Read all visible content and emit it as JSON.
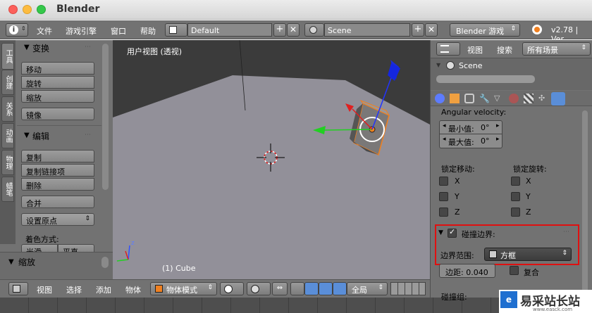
{
  "window": {
    "title": "Blender"
  },
  "menubar": {
    "items": [
      "文件",
      "游戏引擎",
      "窗口",
      "帮助"
    ],
    "layout_value": "Default",
    "scene_value": "Scene",
    "engine_value": "Blender 游戏",
    "version": "v2.78 | Ver"
  },
  "toolshelf": {
    "tabs": [
      "工具",
      "创建",
      "关系",
      "动画",
      "物理",
      "蜡笔"
    ],
    "transform": {
      "title": "变换",
      "buttons": [
        "移动",
        "旋转",
        "缩放"
      ],
      "mirror": "镜像"
    },
    "edit": {
      "title": "编辑",
      "buttons": [
        "复制",
        "复制链接项",
        "删除"
      ],
      "join": "合并",
      "origin": "设置原点",
      "shading_label": "着色方式:",
      "shading_opts": [
        "光滑",
        "平直"
      ]
    },
    "scale_panel": "缩放"
  },
  "viewport": {
    "view_label": "用户视图 (透视)",
    "object_label": "(1) Cube",
    "axis_label": "z"
  },
  "bottombar": {
    "items": [
      "视图",
      "选择",
      "添加",
      "物体"
    ],
    "mode": "物体模式",
    "orientation": "全局"
  },
  "outliner": {
    "menu": [
      "视图",
      "搜索"
    ],
    "filter": "所有场景",
    "scene": "Scene"
  },
  "properties": {
    "angular_velocity": "Angular velocity:",
    "min_label": "最小值:",
    "min_value": "0°",
    "max_label": "最大值:",
    "max_value": "0°",
    "lock_move": "锁定移动:",
    "lock_rot": "锁定旋转:",
    "axes": [
      "X",
      "Y",
      "Z"
    ],
    "bounds_title": "碰撞边界:",
    "bounds_range_label": "边界范围:",
    "bounds_range_value": "方框",
    "margin": "边距: 0.040",
    "compound": "复合",
    "collision_group": "碰撞组:"
  },
  "watermark": {
    "text": "易采站长站",
    "sub": "www.easck.com"
  },
  "colors": {
    "highlight_box": "#e01010",
    "accent_blue": "#5a8ed8",
    "object_orange": "#f08020"
  }
}
